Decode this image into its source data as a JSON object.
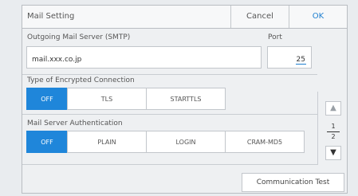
{
  "dialog": {
    "title": "Mail Setting",
    "cancel_label": "Cancel",
    "ok_label": "OK"
  },
  "smtp": {
    "label": "Outgoing Mail Server (SMTP)",
    "value": "mail.xxx.co.jp",
    "port_label": "Port",
    "port_value": "25"
  },
  "encryption": {
    "label": "Type of Encrypted Connection",
    "options": [
      "OFF",
      "TLS",
      "STARTTLS"
    ],
    "selected": "OFF"
  },
  "authentication": {
    "label": "Mail Server Authentication",
    "options": [
      "OFF",
      "PLAIN",
      "LOGIN",
      "CRAM-MD5"
    ],
    "selected": "OFF"
  },
  "pagination": {
    "current": "1",
    "total": "2",
    "up_icon": "up-arrow-icon",
    "down_icon": "down-arrow-icon"
  },
  "communication_test_label": "Communication Test",
  "colors": {
    "accent": "#1f86da",
    "link": "#1f7fd0"
  }
}
